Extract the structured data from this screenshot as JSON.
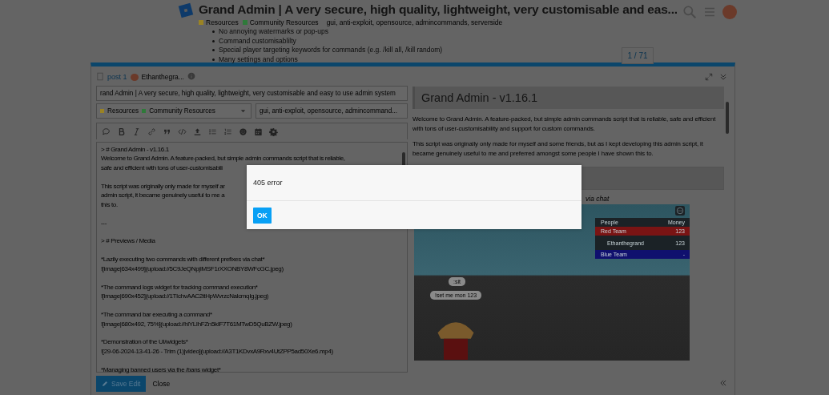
{
  "header": {
    "title": "Grand Admin | A very secure, high quality, lightweight, very customisable and eas...",
    "categories": [
      {
        "name": "Resources",
        "color": "#9a8324"
      },
      {
        "name": "Community Resources",
        "color": "#2f7a3a"
      }
    ],
    "tags": "gui, anti-exploit, opensource, admincommands, serverside"
  },
  "background_list": [
    "No annoying watermarks or pop-ups",
    "Command customisablilty",
    "Special player targeting keywords for commands (e.g. /kill all, /kill random)",
    "Many settings and options"
  ],
  "progress": "1 / 71",
  "composer": {
    "post_label": "post 1",
    "username": "Ethanthegra...",
    "title_value": "rand Admin | A very secure, high quality, lightweight, very customisable and easy to use admin system",
    "categories": [
      {
        "name": "Resources",
        "color": "#9a8324"
      },
      {
        "name": "Community Resources",
        "color": "#2f7a3a"
      }
    ],
    "tags_value": "gui, anti-exploit, opensource, admincommand...",
    "editor_blocks": [
      [
        "> # Grand Admin - v1.16.1",
        "Welcome to Grand Admin. A feature-packed, but simple admin commands script that is reliable,",
        "safe and efficient with tons of user-customisabili"
      ],
      [
        "This script was originally only made for myself ar",
        "admin script, it became genuinely useful to me a",
        "this to."
      ],
      [
        "---"
      ],
      [
        "> # Previews / Media"
      ],
      [
        "*Lazily executing two commands with different prefixes via chat*",
        "![image|634x499](upload://5C9JeQNpjIMSF1rXXONBY8WFcGC.jpeg)"
      ],
      [
        "*The command logs widget for tracking command execution*",
        "![image|690x452](upload://1TIchvAAC2itHpWvrzcNalcmqIg.jpeg)"
      ],
      [
        "*The command bar executing a command*",
        "![image|680x492, 75%](upload://hlYLIhFZn5kIF7T61MTwD5QuBZW.jpeg)"
      ],
      [
        "*Demonstration of the UI/widgets*",
        "![29-06-2024-13-41-26 - Trim (1)|video](upload://A3T1KDvxA9Rxv4UtZPP5ad50Xe6.mp4)"
      ],
      [
        "*Managing banned users via the /bans widget*"
      ]
    ],
    "preview": {
      "heading": "Grand Admin - v1.16.1",
      "paragraphs": [
        "Welcome to Grand Admin. A feature-packed, but simple admin commands script that is reliable, safe and efficient with tons of user-customisability and support for custom commands.",
        "This script was originally only made for myself and some friends, but as I kept developing this admin script, it became genuinely useful to me and preferred amongst some people I have shown this to."
      ],
      "caption": "via chat",
      "game": {
        "columns": [
          "People",
          "Money"
        ],
        "rows": [
          {
            "name": "Red Team",
            "value": "123",
            "kind": "team",
            "color": "#7a1414"
          },
          {
            "name": "Ethanthegrand",
            "value": "123",
            "kind": "player"
          },
          {
            "name": "Blue Team",
            "value": "-",
            "kind": "team",
            "color": "#10106e"
          }
        ],
        "chat": [
          ":sit",
          "!set me mon 123"
        ]
      }
    },
    "save_button": "Save Edit",
    "close": "Close"
  },
  "modal": {
    "message": "405 error",
    "button": "OK"
  }
}
